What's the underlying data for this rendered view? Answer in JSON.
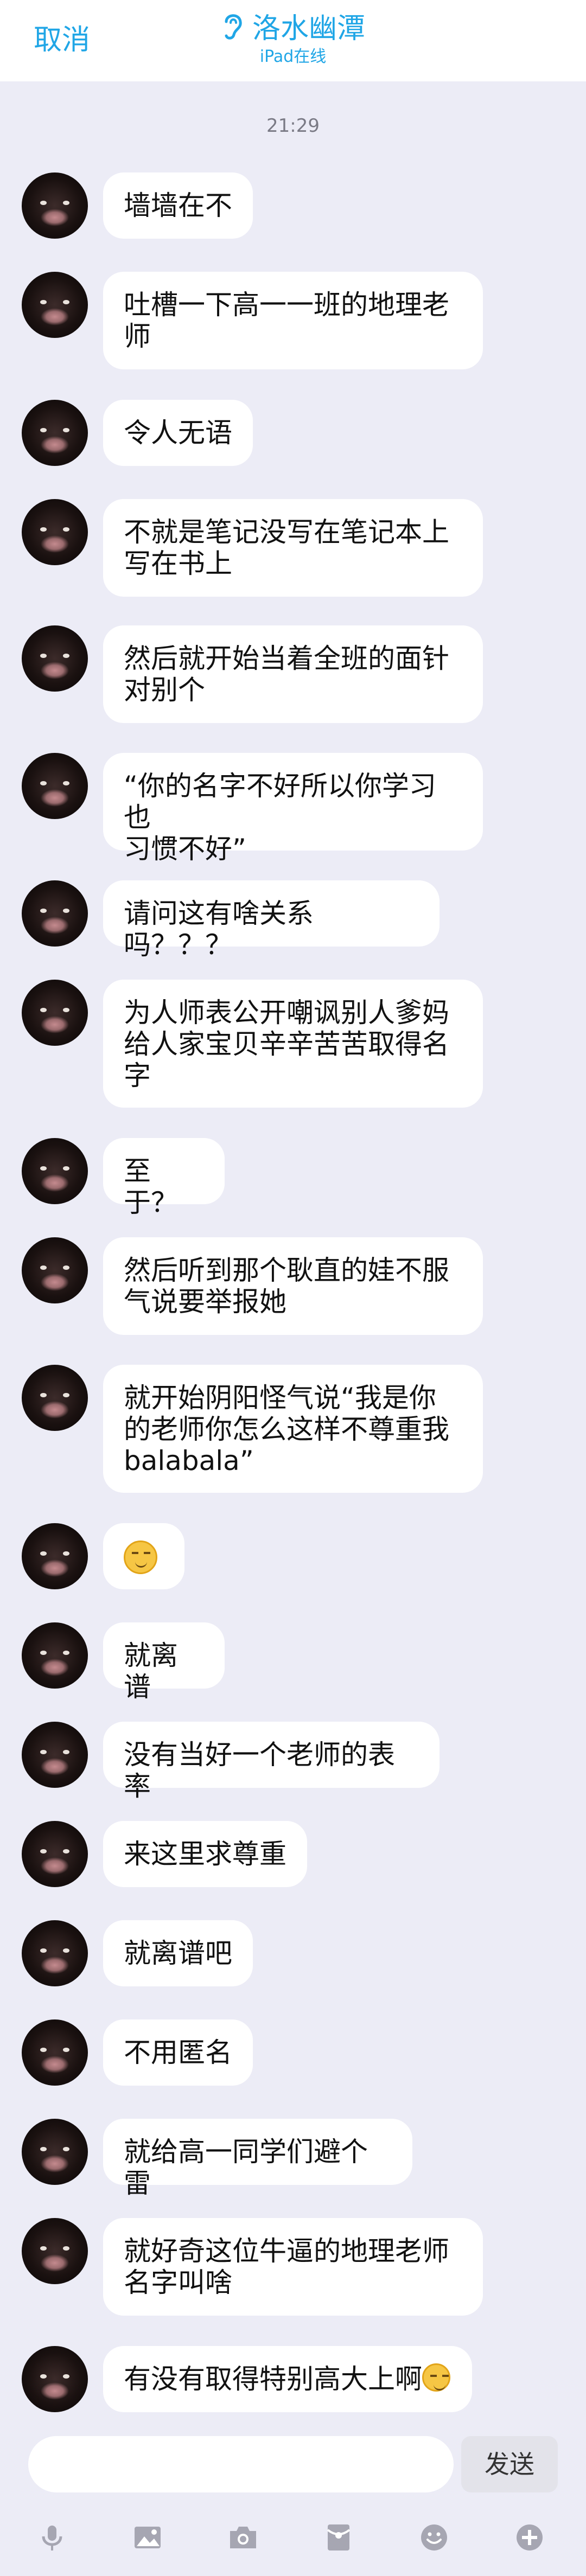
{
  "header": {
    "cancel_label": "取消",
    "contact_name": "洛水幽潭",
    "status": "iPad在线"
  },
  "chat": {
    "timestamp": "21:29",
    "messages": [
      {
        "text": "墙墙在不"
      },
      {
        "text": "吐槽一下高一一班的地理老\n师"
      },
      {
        "text": "令人无语"
      },
      {
        "text": "不就是笔记没写在笔记本上\n写在书上"
      },
      {
        "text": "然后就开始当着全班的面针\n对别个"
      },
      {
        "text": "“你的名字不好所以你学习也\n习惯不好”"
      },
      {
        "text": "请问这有啥关系吗？？？"
      },
      {
        "text": "为人师表公开嘲讽别人爹妈\n给人家宝贝辛辛苦苦取得名\n字"
      },
      {
        "text": "至于？"
      },
      {
        "text": "然后听到那个耿直的娃不服\n气说要举报她"
      },
      {
        "text": "就开始阴阳怪气说“我是你\n的老师你怎么这样不尊重我\nbalabala”"
      },
      {
        "text": "",
        "emoji": "smirk-emoji"
      },
      {
        "text": "就离谱"
      },
      {
        "text": "没有当好一个老师的表率"
      },
      {
        "text": "来这里求尊重"
      },
      {
        "text": "就离谱吧"
      },
      {
        "text": "不用匿名"
      },
      {
        "text": "就给高一同学们避个雷"
      },
      {
        "text": "就好奇这位牛逼的地理老师\n名字叫啥"
      },
      {
        "text": "有没有取得特别高大上啊",
        "emoji": "flushed-emoji"
      }
    ]
  },
  "composer": {
    "input_value": "",
    "send_label": "发送"
  },
  "toolbar": {
    "icons": [
      "microphone-icon",
      "image-icon",
      "camera-icon",
      "red-packet-icon",
      "emoji-icon",
      "plus-icon"
    ]
  },
  "colors": {
    "accent": "#20a6e6",
    "background": "#ececf6",
    "bubble": "#ffffff"
  }
}
